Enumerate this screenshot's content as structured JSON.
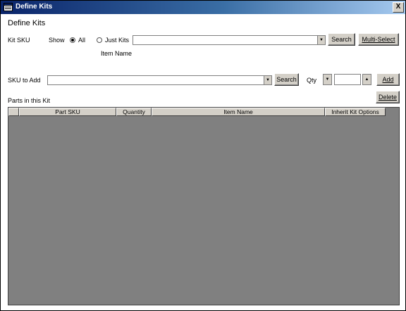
{
  "window": {
    "title": "Define Kits",
    "close_label": "X"
  },
  "page_title": "Define Kits",
  "kit_sku": {
    "label": "Kit SKU",
    "show_label": "Show",
    "radio_all_label": "All",
    "radio_just_kits_label": "Just Kits",
    "item_name_label": "Item Name",
    "combo_value": "",
    "search_label": "Search",
    "multi_select_label": "Multi-Select"
  },
  "sku_to_add": {
    "label": "SKU to Add",
    "combo_value": "",
    "search_label": "Search",
    "qty_label": "Qty",
    "qty_value": "",
    "add_label": "Add"
  },
  "parts": {
    "label": "Parts in this Kit",
    "delete_label": "Delete",
    "columns": [
      "Part SKU",
      "Quantity",
      "Item Name",
      "Inherit Kit Options"
    ],
    "rows": []
  }
}
